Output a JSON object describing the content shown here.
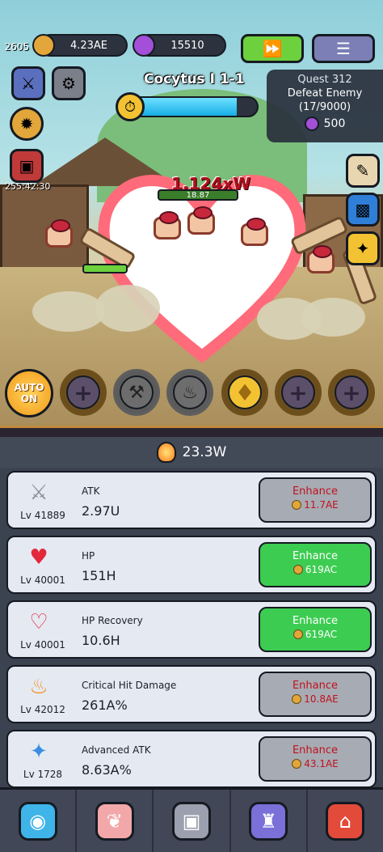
{
  "hud": {
    "level": "2605",
    "gold": "4.23AE",
    "gems": "15510",
    "fast_forward_icon": "fast-forward-icon",
    "menu_icon": "list-menu-icon",
    "event_timer": "255:42:30"
  },
  "stage": {
    "title": "Cocytus I 1-1",
    "timer_fill": 0.84
  },
  "quest": {
    "title": "Quest 312",
    "desc": "Defeat Enemy",
    "progress": "(17/9000)",
    "reward": "500"
  },
  "battle": {
    "damage_text": "1.124xW",
    "enemy_hp": "18.87"
  },
  "skills": {
    "auto_label": "AUTO ON"
  },
  "power": "23.3W",
  "stats": [
    {
      "icon": "sword-icon",
      "level": "Lv 41889",
      "name": "ATK",
      "value": "2.97U",
      "button": "Enhance",
      "cost": "11.7AE",
      "affordable": false
    },
    {
      "icon": "heart-icon",
      "level": "Lv 40001",
      "name": "HP",
      "value": "151H",
      "button": "Enhance",
      "cost": "619AC",
      "affordable": true
    },
    {
      "icon": "heart-plus-icon",
      "level": "Lv 40001",
      "name": "HP Recovery",
      "value": "10.6H",
      "button": "Enhance",
      "cost": "619AC",
      "affordable": true
    },
    {
      "icon": "flame-sword-icon",
      "level": "Lv 42012",
      "name": "Critical Hit Damage",
      "value": "261A%",
      "button": "Enhance",
      "cost": "10.8AE",
      "affordable": false
    },
    {
      "icon": "sparkle-sword-icon",
      "level": "Lv 1728",
      "name": "Advanced ATK",
      "value": "8.63A%",
      "button": "Enhance",
      "cost": "43.1AE",
      "affordable": false
    }
  ],
  "nav": [
    {
      "icon": "blue-slime-icon"
    },
    {
      "icon": "chicken-icon"
    },
    {
      "icon": "portal-icon"
    },
    {
      "icon": "castle-icon"
    },
    {
      "icon": "shop-icon"
    }
  ],
  "colors": {
    "enhance_ok": "#3dcc52",
    "enhance_disabled": "#a7abb3",
    "cost_red": "#c0121f",
    "accent_gold": "#f2c232"
  }
}
